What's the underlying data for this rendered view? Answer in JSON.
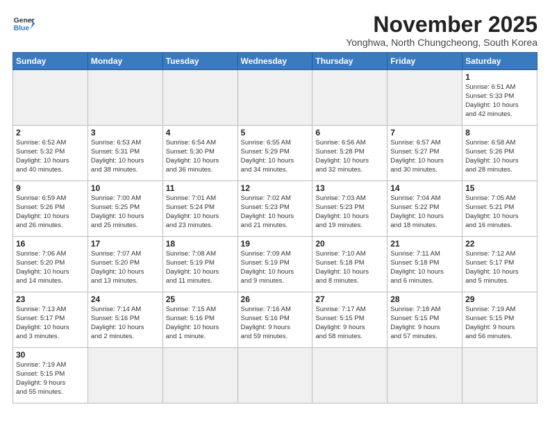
{
  "logo": {
    "line1": "General",
    "line2": "Blue"
  },
  "title": "November 2025",
  "subtitle": "Yonghwa, North Chungcheong, South Korea",
  "weekdays": [
    "Sunday",
    "Monday",
    "Tuesday",
    "Wednesday",
    "Thursday",
    "Friday",
    "Saturday"
  ],
  "weeks": [
    [
      {
        "day": "",
        "info": ""
      },
      {
        "day": "",
        "info": ""
      },
      {
        "day": "",
        "info": ""
      },
      {
        "day": "",
        "info": ""
      },
      {
        "day": "",
        "info": ""
      },
      {
        "day": "",
        "info": ""
      },
      {
        "day": "1",
        "info": "Sunrise: 6:51 AM\nSunset: 5:33 PM\nDaylight: 10 hours\nand 42 minutes."
      }
    ],
    [
      {
        "day": "2",
        "info": "Sunrise: 6:52 AM\nSunset: 5:32 PM\nDaylight: 10 hours\nand 40 minutes."
      },
      {
        "day": "3",
        "info": "Sunrise: 6:53 AM\nSunset: 5:31 PM\nDaylight: 10 hours\nand 38 minutes."
      },
      {
        "day": "4",
        "info": "Sunrise: 6:54 AM\nSunset: 5:30 PM\nDaylight: 10 hours\nand 36 minutes."
      },
      {
        "day": "5",
        "info": "Sunrise: 6:55 AM\nSunset: 5:29 PM\nDaylight: 10 hours\nand 34 minutes."
      },
      {
        "day": "6",
        "info": "Sunrise: 6:56 AM\nSunset: 5:28 PM\nDaylight: 10 hours\nand 32 minutes."
      },
      {
        "day": "7",
        "info": "Sunrise: 6:57 AM\nSunset: 5:27 PM\nDaylight: 10 hours\nand 30 minutes."
      },
      {
        "day": "8",
        "info": "Sunrise: 6:58 AM\nSunset: 5:26 PM\nDaylight: 10 hours\nand 28 minutes."
      }
    ],
    [
      {
        "day": "9",
        "info": "Sunrise: 6:59 AM\nSunset: 5:26 PM\nDaylight: 10 hours\nand 26 minutes."
      },
      {
        "day": "10",
        "info": "Sunrise: 7:00 AM\nSunset: 5:25 PM\nDaylight: 10 hours\nand 25 minutes."
      },
      {
        "day": "11",
        "info": "Sunrise: 7:01 AM\nSunset: 5:24 PM\nDaylight: 10 hours\nand 23 minutes."
      },
      {
        "day": "12",
        "info": "Sunrise: 7:02 AM\nSunset: 5:23 PM\nDaylight: 10 hours\nand 21 minutes."
      },
      {
        "day": "13",
        "info": "Sunrise: 7:03 AM\nSunset: 5:23 PM\nDaylight: 10 hours\nand 19 minutes."
      },
      {
        "day": "14",
        "info": "Sunrise: 7:04 AM\nSunset: 5:22 PM\nDaylight: 10 hours\nand 18 minutes."
      },
      {
        "day": "15",
        "info": "Sunrise: 7:05 AM\nSunset: 5:21 PM\nDaylight: 10 hours\nand 16 minutes."
      }
    ],
    [
      {
        "day": "16",
        "info": "Sunrise: 7:06 AM\nSunset: 5:20 PM\nDaylight: 10 hours\nand 14 minutes."
      },
      {
        "day": "17",
        "info": "Sunrise: 7:07 AM\nSunset: 5:20 PM\nDaylight: 10 hours\nand 13 minutes."
      },
      {
        "day": "18",
        "info": "Sunrise: 7:08 AM\nSunset: 5:19 PM\nDaylight: 10 hours\nand 11 minutes."
      },
      {
        "day": "19",
        "info": "Sunrise: 7:09 AM\nSunset: 5:19 PM\nDaylight: 10 hours\nand 9 minutes."
      },
      {
        "day": "20",
        "info": "Sunrise: 7:10 AM\nSunset: 5:18 PM\nDaylight: 10 hours\nand 8 minutes."
      },
      {
        "day": "21",
        "info": "Sunrise: 7:11 AM\nSunset: 5:18 PM\nDaylight: 10 hours\nand 6 minutes."
      },
      {
        "day": "22",
        "info": "Sunrise: 7:12 AM\nSunset: 5:17 PM\nDaylight: 10 hours\nand 5 minutes."
      }
    ],
    [
      {
        "day": "23",
        "info": "Sunrise: 7:13 AM\nSunset: 5:17 PM\nDaylight: 10 hours\nand 3 minutes."
      },
      {
        "day": "24",
        "info": "Sunrise: 7:14 AM\nSunset: 5:16 PM\nDaylight: 10 hours\nand 2 minutes."
      },
      {
        "day": "25",
        "info": "Sunrise: 7:15 AM\nSunset: 5:16 PM\nDaylight: 10 hours\nand 1 minute."
      },
      {
        "day": "26",
        "info": "Sunrise: 7:16 AM\nSunset: 5:16 PM\nDaylight: 9 hours\nand 59 minutes."
      },
      {
        "day": "27",
        "info": "Sunrise: 7:17 AM\nSunset: 5:15 PM\nDaylight: 9 hours\nand 58 minutes."
      },
      {
        "day": "28",
        "info": "Sunrise: 7:18 AM\nSunset: 5:15 PM\nDaylight: 9 hours\nand 57 minutes."
      },
      {
        "day": "29",
        "info": "Sunrise: 7:19 AM\nSunset: 5:15 PM\nDaylight: 9 hours\nand 56 minutes."
      }
    ],
    [
      {
        "day": "30",
        "info": "Sunrise: 7:19 AM\nSunset: 5:15 PM\nDaylight: 9 hours\nand 55 minutes."
      },
      {
        "day": "",
        "info": ""
      },
      {
        "day": "",
        "info": ""
      },
      {
        "day": "",
        "info": ""
      },
      {
        "day": "",
        "info": ""
      },
      {
        "day": "",
        "info": ""
      },
      {
        "day": "",
        "info": ""
      }
    ]
  ]
}
